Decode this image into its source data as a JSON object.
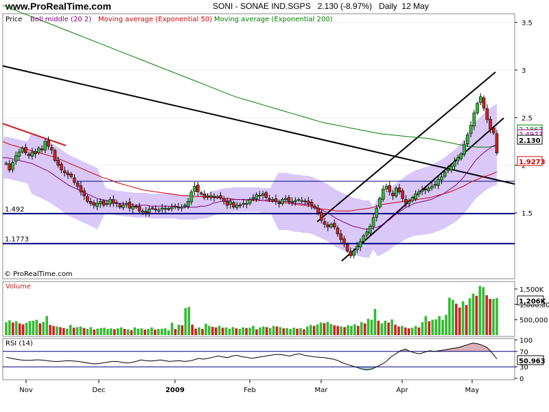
{
  "header": {
    "site": "www.ProRealTime.com",
    "title": "SONI - SONAE IND.SGPS   2.130 (-8.97%)   Daily  12 May"
  },
  "colors": {
    "bollinger": "#800080",
    "bollinger_band": "#d9c8f8",
    "ema50": "#d00000",
    "ema200": "#008000",
    "up": "#33bb33",
    "down": "#cc2222",
    "support": "#000080",
    "trend": "#000000"
  },
  "chart_data": [
    {
      "type": "candlestick",
      "panel": "price",
      "legend": [
        "Price",
        "Boll middle (20 2)",
        "Moving average (Exponential 50)",
        "Moving average (Exponential 200)"
      ],
      "ylim": [
        0.97,
        3.95
      ],
      "y_ticks": [
        1.5,
        2,
        2.5,
        3,
        3.5
      ],
      "x_labels": [
        "Nov",
        "Dec",
        "2009",
        "Feb",
        "Mar",
        "Apr",
        "May"
      ],
      "horizontal_lines": [
        {
          "label": "1.492",
          "value": 1.492
        },
        {
          "label": "1.1773",
          "value": 1.1773
        }
      ],
      "right_labels": {
        "last": "2.130",
        "boll_upper": "2.4977",
        "ema50": "1.9273",
        "ema200": "2.1862"
      },
      "watermark": "© ProRealTime.com",
      "candle_closes": [
        2.02,
        1.95,
        2.03,
        2.1,
        2.14,
        2.18,
        2.13,
        2.1,
        2.14,
        2.12,
        2.18,
        2.16,
        2.25,
        2.2,
        2.16,
        2.05,
        2.0,
        1.95,
        1.92,
        1.9,
        1.88,
        1.82,
        1.78,
        1.72,
        1.68,
        1.62,
        1.6,
        1.58,
        1.6,
        1.62,
        1.58,
        1.6,
        1.64,
        1.6,
        1.6,
        1.56,
        1.58,
        1.6,
        1.55,
        1.57,
        1.56,
        1.52,
        1.52,
        1.5,
        1.54,
        1.55,
        1.53,
        1.53,
        1.55,
        1.55,
        1.54,
        1.56,
        1.57,
        1.56,
        1.56,
        1.58,
        1.62,
        1.72,
        1.78,
        1.72,
        1.7,
        1.66,
        1.68,
        1.68,
        1.66,
        1.67,
        1.66,
        1.62,
        1.58,
        1.62,
        1.56,
        1.58,
        1.58,
        1.6,
        1.6,
        1.64,
        1.66,
        1.69,
        1.68,
        1.7,
        1.66,
        1.64,
        1.64,
        1.62,
        1.6,
        1.64,
        1.65,
        1.62,
        1.62,
        1.63,
        1.64,
        1.63,
        1.62,
        1.6,
        1.58,
        1.55,
        1.5,
        1.42,
        1.38,
        1.35,
        1.38,
        1.35,
        1.28,
        1.22,
        1.18,
        1.1,
        1.05,
        1.1,
        1.15,
        1.2,
        1.26,
        1.3,
        1.36,
        1.45,
        1.55,
        1.65,
        1.75,
        1.78,
        1.72,
        1.68,
        1.76,
        1.72,
        1.65,
        1.6,
        1.62,
        1.66,
        1.7,
        1.72,
        1.74,
        1.74,
        1.76,
        1.78,
        1.8,
        1.85,
        1.88,
        1.93,
        1.96,
        1.99,
        2.04,
        2.08,
        2.12,
        2.22,
        2.32,
        2.42,
        2.55,
        2.65,
        2.72,
        2.6,
        2.48,
        2.38,
        2.34,
        2.13
      ],
      "boll_middle": [
        2.08,
        2.08,
        2.07,
        2.06,
        2.05,
        2.04,
        2.03,
        2.02,
        2.0,
        1.98,
        1.96,
        1.94,
        1.91,
        1.88,
        1.85,
        1.82,
        1.79,
        1.77,
        1.75,
        1.73,
        1.71,
        1.69,
        1.67,
        1.65,
        1.64,
        1.63,
        1.62,
        1.61,
        1.6,
        1.6,
        1.59,
        1.59,
        1.58,
        1.58,
        1.58,
        1.58,
        1.57,
        1.57,
        1.57,
        1.57,
        1.57,
        1.57,
        1.57,
        1.56,
        1.56,
        1.56,
        1.56,
        1.56,
        1.57,
        1.57,
        1.58,
        1.6,
        1.61,
        1.62,
        1.63,
        1.63,
        1.64,
        1.64,
        1.64,
        1.64,
        1.64,
        1.64,
        1.64,
        1.63,
        1.63,
        1.63,
        1.63,
        1.62,
        1.62,
        1.62,
        1.61,
        1.6,
        1.6,
        1.59,
        1.59,
        1.58,
        1.56,
        1.54,
        1.52,
        1.5,
        1.47,
        1.44,
        1.42,
        1.4,
        1.38,
        1.36,
        1.35,
        1.34,
        1.33,
        1.33,
        1.34,
        1.35,
        1.37,
        1.4,
        1.43,
        1.47,
        1.5,
        1.53,
        1.56,
        1.58,
        1.6,
        1.61,
        1.62,
        1.63,
        1.64,
        1.66,
        1.68,
        1.7,
        1.73,
        1.76,
        1.79,
        1.83,
        1.88,
        1.94,
        2.0,
        2.06,
        2.1,
        2.14,
        2.17,
        2.2,
        2.22
      ],
      "ema50": [
        2.25,
        2.22,
        2.2,
        2.18,
        2.16,
        2.14,
        2.12,
        2.1,
        2.08,
        2.05,
        2.02,
        1.99,
        1.96,
        1.93,
        1.9,
        1.87,
        1.85,
        1.82,
        1.8,
        1.78,
        1.76,
        1.74,
        1.73,
        1.72,
        1.71,
        1.7,
        1.69,
        1.68,
        1.68,
        1.67,
        1.67,
        1.66,
        1.66,
        1.65,
        1.65,
        1.64,
        1.64,
        1.63,
        1.63,
        1.63,
        1.62,
        1.62,
        1.61,
        1.6,
        1.59,
        1.58,
        1.57,
        1.55,
        1.54,
        1.53,
        1.52,
        1.52,
        1.52,
        1.53,
        1.54,
        1.55,
        1.57,
        1.59,
        1.6,
        1.61,
        1.62,
        1.63,
        1.64,
        1.65,
        1.66,
        1.68,
        1.7,
        1.72,
        1.75,
        1.78,
        1.82,
        1.85,
        1.88,
        1.9,
        1.93
      ],
      "ema200": [
        3.68,
        3.64,
        3.6,
        3.56,
        3.52,
        3.48,
        3.44,
        3.4,
        3.36,
        3.32,
        3.28,
        3.24,
        3.2,
        3.16,
        3.12,
        3.08,
        3.04,
        3.0,
        2.96,
        2.92,
        2.88,
        2.84,
        2.8,
        2.76,
        2.72,
        2.69,
        2.66,
        2.63,
        2.6,
        2.57,
        2.54,
        2.51,
        2.48,
        2.45,
        2.43,
        2.41,
        2.39,
        2.37,
        2.35,
        2.33,
        2.32,
        2.31,
        2.3,
        2.29,
        2.28,
        2.26,
        2.24,
        2.22,
        2.2,
        2.19,
        2.19,
        2.2
      ]
    },
    {
      "type": "bar",
      "panel": "volume",
      "name": "Volume",
      "ylim": [
        0,
        1700000
      ],
      "y_ticks_labels": [
        "1,500K",
        "1,000,000",
        "500,000"
      ],
      "y_ticks": [
        1500000,
        1000000,
        500000
      ],
      "last_label": "1,206K",
      "values": [
        420,
        480,
        410,
        450,
        380,
        350,
        400,
        460,
        470,
        500,
        380,
        430,
        620,
        330,
        300,
        280,
        260,
        230,
        210,
        330,
        240,
        260,
        280,
        230,
        200,
        260,
        180,
        210,
        230,
        240,
        200,
        220,
        190,
        220,
        250,
        200,
        190,
        160,
        250,
        210,
        220,
        180,
        200,
        250,
        180,
        200,
        210,
        220,
        150,
        400,
        200,
        340,
        320,
        880,
        920,
        340,
        210,
        250,
        200,
        370,
        300,
        270,
        250,
        300,
        240,
        250,
        210,
        260,
        220,
        200,
        250,
        230,
        240,
        300,
        190,
        250,
        280,
        260,
        230,
        300,
        280,
        260,
        220,
        230,
        200,
        240,
        210,
        230,
        190,
        280,
        330,
        300,
        350,
        410,
        390,
        430,
        360,
        320,
        300,
        280,
        260,
        320,
        300,
        350,
        300,
        420,
        380,
        530,
        500,
        850,
        470,
        380,
        470,
        410,
        510,
        340,
        280,
        300,
        250,
        220,
        240,
        300,
        250,
        420,
        620,
        450,
        500,
        510,
        620,
        500,
        660,
        1220,
        1150,
        1020,
        900,
        1100,
        980,
        1200,
        1350,
        1280,
        1600,
        1560,
        1300,
        1180,
        1180,
        1206
      ],
      "value_unit": "thousands"
    },
    {
      "type": "line",
      "panel": "rsi",
      "name": "RSI (14)",
      "ylim": [
        0,
        100
      ],
      "y_ticks": [
        0,
        30,
        70,
        100
      ],
      "last_label": "50.963",
      "values": [
        55,
        52,
        50,
        48,
        47,
        47,
        48,
        48,
        47,
        45,
        44,
        44,
        45,
        46,
        45,
        44,
        42,
        40,
        38,
        38,
        40,
        42,
        44,
        44,
        42,
        40,
        41,
        44,
        48,
        46,
        45,
        46,
        48,
        46,
        44,
        45,
        46,
        44,
        45,
        48,
        52,
        50,
        52,
        55,
        58,
        56,
        54,
        58,
        60,
        56,
        55,
        52,
        54,
        56,
        58,
        60,
        62,
        62,
        60,
        58,
        62,
        64,
        60,
        58,
        56,
        55,
        54,
        52,
        50,
        46,
        40,
        36,
        32,
        28,
        24,
        22,
        24,
        30,
        36,
        44,
        56,
        64,
        72,
        76,
        70,
        66,
        64,
        68,
        72,
        70,
        72,
        74,
        76,
        78,
        80,
        84,
        88,
        92,
        90,
        86,
        80,
        66,
        50.963
      ]
    }
  ]
}
